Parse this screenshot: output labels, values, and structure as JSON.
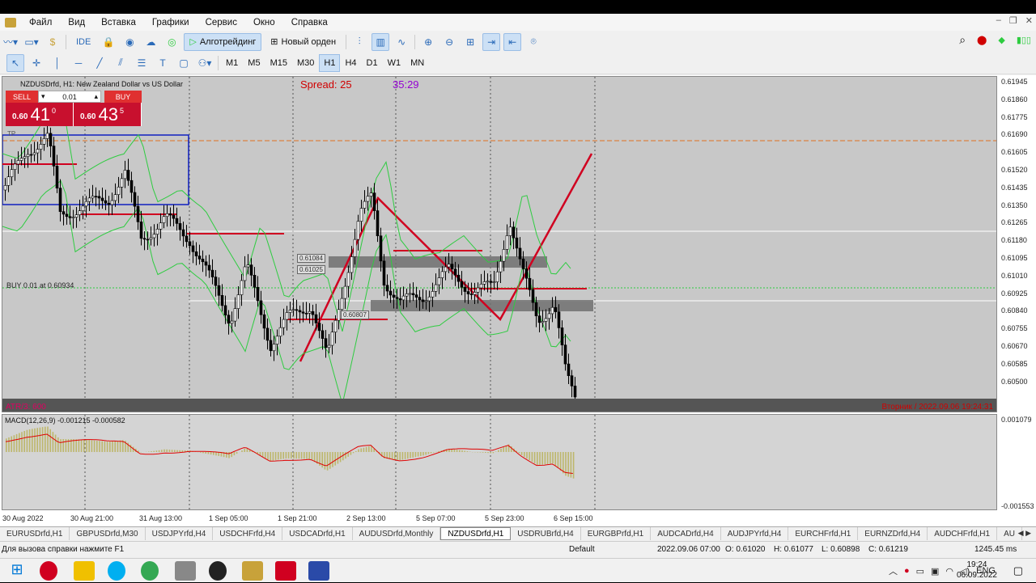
{
  "menu": [
    "Файл",
    "Вид",
    "Вставка",
    "Графики",
    "Сервис",
    "Окно",
    "Справка"
  ],
  "toolbar": {
    "ide": "IDE",
    "algo": "Алготрейдинг",
    "new_order": "Новый орден"
  },
  "timeframes": [
    "M1",
    "M5",
    "M15",
    "M30",
    "H1",
    "H4",
    "D1",
    "W1",
    "MN"
  ],
  "active_timeframe": "H1",
  "chart": {
    "title": "NZDUSDrfd, H1:  New Zealand Dollar vs US Dollar",
    "spread": "Spread: 25",
    "timer": "35:29",
    "sell_label": "SELL",
    "buy_label": "BUY",
    "lot": "0.01",
    "sell_small": "0.60",
    "sell_big": "41",
    "sell_sup": "0",
    "buy_small": "0.60",
    "buy_big": "43",
    "buy_sup": "5",
    "position_label": "BUY 0.01 at 0.60934",
    "tp_label": "TP",
    "atr_label": "ATR/3: 600",
    "date_label": "Вторник / 2022.09.06 19:24:31",
    "rect_labels": [
      "0.61084",
      "0.61025",
      "0.60807"
    ],
    "macd_label": "MACD(12,26,9) -0.001215 -0.000582"
  },
  "price_axis": [
    "0.61945",
    "0.61860",
    "0.61775",
    "0.61690",
    "0.61605",
    "0.61520",
    "0.61435",
    "0.61350",
    "0.61265",
    "0.61180",
    "0.61095",
    "0.61010",
    "0.60925",
    "0.60840",
    "0.60755",
    "0.60670",
    "0.60585",
    "0.60500"
  ],
  "macd_axis": [
    "0.001079",
    "-0.001553"
  ],
  "time_axis": [
    "30 Aug 2022",
    "30 Aug 21:00",
    "31 Aug 13:00",
    "1 Sep 05:00",
    "1 Sep 21:00",
    "2 Sep 13:00",
    "5 Sep 07:00",
    "5 Sep 23:00",
    "6 Sep 15:00"
  ],
  "tabs": [
    "EURUSDrfd,H1",
    "GBPUSDrfd,M30",
    "USDJPYrfd,H4",
    "USDCHFrfd,H4",
    "USDCADrfd,H1",
    "AUDUSDrfd,Monthly",
    "NZDUSDrfd,H1",
    "USDRUBrfd,H4",
    "EURGBPrfd,H1",
    "AUDCADrfd,H4",
    "AUDJPYrfd,H4",
    "EURCHFrfd,H1",
    "EURNZDrfd,H4",
    "AUDCHFrfd,H1",
    "AU"
  ],
  "active_tab": "NZDUSDrfd,H1",
  "status": {
    "help": "Для вызова справки нажмите F1",
    "profile": "Default",
    "datetime": "2022.09.06 07:00",
    "open": "O: 0.61020",
    "high": "H: 0.61077",
    "low": "L: 0.60898",
    "close": "C: 0.61219",
    "ping": "1245.45 ms"
  },
  "taskbar": {
    "lang": "ENG",
    "time": "19:24",
    "date": "06.09.2022"
  },
  "colors": {
    "sell": "#e03030",
    "quote": "#c8102e",
    "spread": "#d00000",
    "timer": "#9400d3",
    "trend": "#d00020",
    "band": "#2ecc40",
    "macd_hist": "#bdb76b"
  }
}
